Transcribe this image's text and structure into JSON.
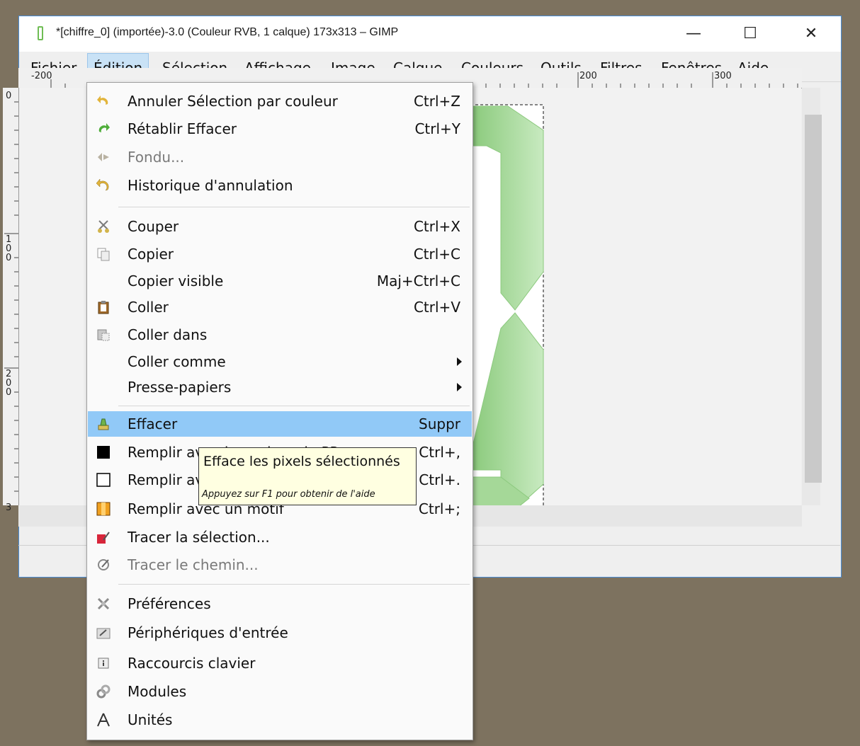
{
  "window": {
    "title": "*[chiffre_0] (importée)-3.0 (Couleur RVB, 1 calque) 173x313 – GIMP",
    "minimize_glyph": "—",
    "maximize_glyph": "☐",
    "close_glyph": "✕"
  },
  "menubar": {
    "items": [
      {
        "label": "Fichier"
      },
      {
        "label": "Édition",
        "active": true
      },
      {
        "label": "Sélection"
      },
      {
        "label": "Affichage"
      },
      {
        "label": "Image"
      },
      {
        "label": "Calque"
      },
      {
        "label": "Couleurs"
      },
      {
        "label": "Outils"
      },
      {
        "label": "Filtres"
      },
      {
        "label": "Fenêtres"
      },
      {
        "label": "Aide"
      }
    ]
  },
  "rulers": {
    "h_labels": [
      "-200",
      "200",
      "300"
    ],
    "v_labels": [
      "0",
      "100",
      "200",
      "3"
    ]
  },
  "menu": {
    "items": [
      {
        "label": "Annuler Sélection par couleur",
        "shortcut": "Ctrl+Z",
        "icon": "undo-icon"
      },
      {
        "label": "Rétablir Effacer",
        "shortcut": "Ctrl+Y",
        "icon": "redo-icon"
      },
      {
        "label": "Fondu...",
        "shortcut": "",
        "icon": "fade-icon",
        "disabled": true
      },
      {
        "label": "Historique d'annulation",
        "shortcut": "",
        "icon": "undo-history-icon"
      },
      {
        "label": "Couper",
        "shortcut": "Ctrl+X",
        "icon": "cut-icon"
      },
      {
        "label": "Copier",
        "shortcut": "Ctrl+C",
        "icon": "copy-icon"
      },
      {
        "label": "Copier visible",
        "shortcut": "Maj+Ctrl+C",
        "icon": ""
      },
      {
        "label": "Coller",
        "shortcut": "Ctrl+V",
        "icon": "paste-icon"
      },
      {
        "label": "Coller dans",
        "shortcut": "",
        "icon": "paste-into-icon"
      },
      {
        "label": "Coller comme",
        "shortcut": "",
        "icon": "",
        "submenu": true
      },
      {
        "label": "Presse-papiers",
        "shortcut": "",
        "icon": "",
        "submenu": true
      },
      {
        "label": "Effacer",
        "shortcut": "Suppr",
        "icon": "clear-icon",
        "highlighted": true
      },
      {
        "label": "Remplir avec la couleur de PP",
        "shortcut": "Ctrl+,",
        "icon": "fill-fg-icon"
      },
      {
        "label": "Remplir avec la couleur d'AP",
        "shortcut": "Ctrl+.",
        "icon": "fill-bg-icon"
      },
      {
        "label": "Remplir avec un motif",
        "shortcut": "Ctrl+;",
        "icon": "fill-pattern-icon"
      },
      {
        "label": "Tracer la sélection...",
        "shortcut": "",
        "icon": "stroke-selection-icon"
      },
      {
        "label": "Tracer le chemin...",
        "shortcut": "",
        "icon": "stroke-path-icon",
        "disabled": true
      },
      {
        "label": "Préférences",
        "shortcut": "",
        "icon": "preferences-icon"
      },
      {
        "label": "Périphériques d'entrée",
        "shortcut": "",
        "icon": "input-devices-icon"
      },
      {
        "label": "Raccourcis clavier",
        "shortcut": "",
        "icon": "keyboard-shortcuts-icon"
      },
      {
        "label": "Modules",
        "shortcut": "",
        "icon": "modules-icon"
      },
      {
        "label": "Unités",
        "shortcut": "",
        "icon": "units-icon"
      }
    ]
  },
  "tooltip": {
    "main": "Efface les pixels sélectionnés",
    "help": "Appuyez sur F1 pour obtenir de l'aide"
  },
  "colors": {
    "highlight": "#91c9f7",
    "digit_green": "#a7d99b",
    "desktop": "#7d725f"
  }
}
